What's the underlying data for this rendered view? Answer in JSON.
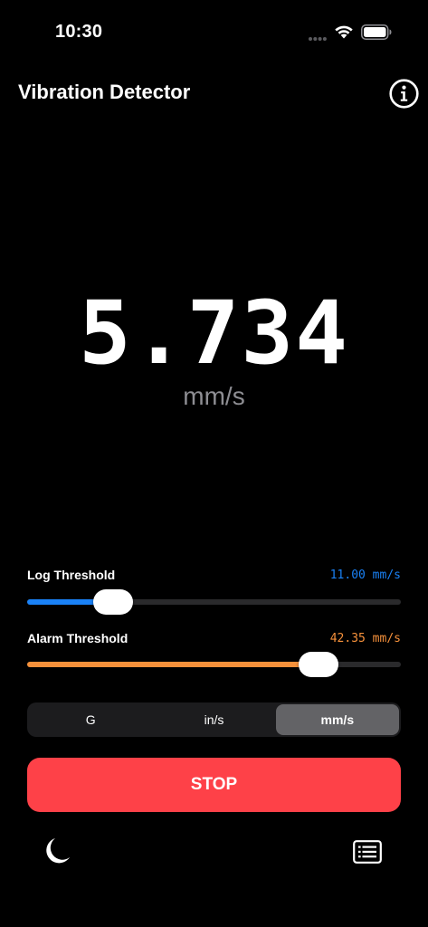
{
  "status_bar": {
    "time": "10:30"
  },
  "nav": {
    "title": "Vibration Detector",
    "info_icon": "info-circle-icon"
  },
  "reading": {
    "value": "5.734",
    "unit": "mm/s"
  },
  "log_threshold": {
    "label": "Log Threshold",
    "value_text": "11.00 mm/s",
    "fraction": 0.23,
    "color": "#1a82f7"
  },
  "alarm_threshold": {
    "label": "Alarm Threshold",
    "value_text": "42.35 mm/s",
    "fraction": 0.78,
    "color": "#f6913b"
  },
  "units": {
    "options": [
      "G",
      "in/s",
      "mm/s"
    ],
    "selected": "mm/s"
  },
  "stop_button": {
    "label": "STOP",
    "color": "#fe4148"
  },
  "bottom_bar": {
    "left_icon": "moon-icon",
    "right_icon": "list-icon"
  }
}
